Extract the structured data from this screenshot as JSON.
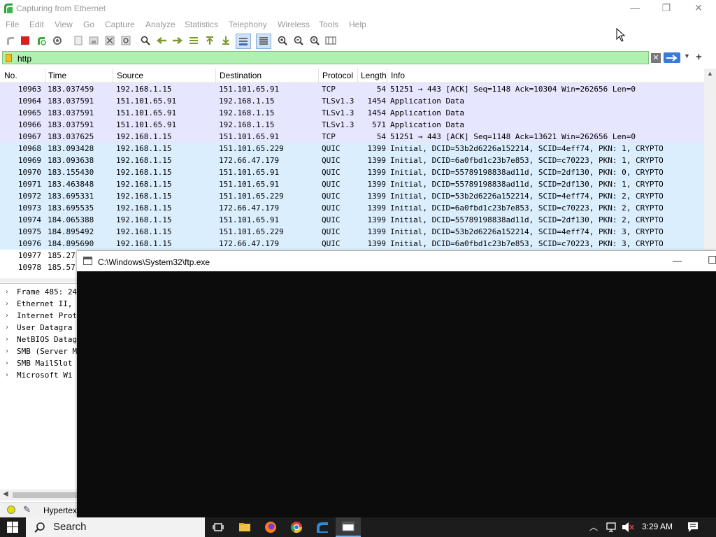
{
  "window": {
    "title": "Capturing from Ethernet",
    "min": "—",
    "max": "❐",
    "close": "✕"
  },
  "menu": [
    "File",
    "Edit",
    "View",
    "Go",
    "Capture",
    "Analyze",
    "Statistics",
    "Telephony",
    "Wireless",
    "Tools",
    "Help"
  ],
  "filter": {
    "value": "http",
    "add_label": "+"
  },
  "columns": {
    "no": "No.",
    "time": "Time",
    "source": "Source",
    "destination": "Destination",
    "protocol": "Protocol",
    "length": "Length",
    "info": "Info"
  },
  "packets": [
    {
      "no": "10963",
      "time": "183.037459",
      "src": "192.168.1.15",
      "dst": "151.101.65.91",
      "proto": "TCP",
      "len": "54",
      "info": "51251 → 443 [ACK] Seq=1148 Ack=10304 Win=262656 Len=0"
    },
    {
      "no": "10964",
      "time": "183.037591",
      "src": "151.101.65.91",
      "dst": "192.168.1.15",
      "proto": "TLSv1.3",
      "len": "1454",
      "info": "Application Data"
    },
    {
      "no": "10965",
      "time": "183.037591",
      "src": "151.101.65.91",
      "dst": "192.168.1.15",
      "proto": "TLSv1.3",
      "len": "1454",
      "info": "Application Data"
    },
    {
      "no": "10966",
      "time": "183.037591",
      "src": "151.101.65.91",
      "dst": "192.168.1.15",
      "proto": "TLSv1.3",
      "len": "571",
      "info": "Application Data"
    },
    {
      "no": "10967",
      "time": "183.037625",
      "src": "192.168.1.15",
      "dst": "151.101.65.91",
      "proto": "TCP",
      "len": "54",
      "info": "51251 → 443 [ACK] Seq=1148 Ack=13621 Win=262656 Len=0"
    },
    {
      "no": "10968",
      "time": "183.093428",
      "src": "192.168.1.15",
      "dst": "151.101.65.229",
      "proto": "QUIC",
      "len": "1399",
      "info": "Initial, DCID=53b2d6226a152214, SCID=4eff74, PKN: 1, CRYPTO"
    },
    {
      "no": "10969",
      "time": "183.093638",
      "src": "192.168.1.15",
      "dst": "172.66.47.179",
      "proto": "QUIC",
      "len": "1399",
      "info": "Initial, DCID=6a0fbd1c23b7e853, SCID=c70223, PKN: 1, CRYPTO"
    },
    {
      "no": "10970",
      "time": "183.155430",
      "src": "192.168.1.15",
      "dst": "151.101.65.91",
      "proto": "QUIC",
      "len": "1399",
      "info": "Initial, DCID=55789198838ad11d, SCID=2df130, PKN: 0, CRYPTO"
    },
    {
      "no": "10971",
      "time": "183.463848",
      "src": "192.168.1.15",
      "dst": "151.101.65.91",
      "proto": "QUIC",
      "len": "1399",
      "info": "Initial, DCID=55789198838ad11d, SCID=2df130, PKN: 1, CRYPTO"
    },
    {
      "no": "10972",
      "time": "183.695331",
      "src": "192.168.1.15",
      "dst": "151.101.65.229",
      "proto": "QUIC",
      "len": "1399",
      "info": "Initial, DCID=53b2d6226a152214, SCID=4eff74, PKN: 2, CRYPTO"
    },
    {
      "no": "10973",
      "time": "183.695535",
      "src": "192.168.1.15",
      "dst": "172.66.47.179",
      "proto": "QUIC",
      "len": "1399",
      "info": "Initial, DCID=6a0fbd1c23b7e853, SCID=c70223, PKN: 2, CRYPTO"
    },
    {
      "no": "10974",
      "time": "184.065388",
      "src": "192.168.1.15",
      "dst": "151.101.65.91",
      "proto": "QUIC",
      "len": "1399",
      "info": "Initial, DCID=55789198838ad11d, SCID=2df130, PKN: 2, CRYPTO"
    },
    {
      "no": "10975",
      "time": "184.895492",
      "src": "192.168.1.15",
      "dst": "151.101.65.229",
      "proto": "QUIC",
      "len": "1399",
      "info": "Initial, DCID=53b2d6226a152214, SCID=4eff74, PKN: 3, CRYPTO"
    },
    {
      "no": "10976",
      "time": "184.895690",
      "src": "192.168.1.15",
      "dst": "172.66.47.179",
      "proto": "QUIC",
      "len": "1399",
      "info": "Initial, DCID=6a0fbd1c23b7e853, SCID=c70223, PKN: 3, CRYPTO"
    },
    {
      "no": "10977",
      "time": "185.27",
      "src": "",
      "dst": "",
      "proto": "",
      "len": "",
      "info": ""
    },
    {
      "no": "10978",
      "time": "185.57",
      "src": "",
      "dst": "",
      "proto": "",
      "len": "",
      "info": ""
    }
  ],
  "details": [
    "Frame 485: 24",
    "Ethernet II,",
    "Internet Prot",
    "User Datagra",
    "NetBIOS Datag",
    "SMB (Server M",
    "SMB MailSlot",
    "Microsoft Wi"
  ],
  "status": {
    "text": "Hypertex"
  },
  "ftp_window": {
    "title": "C:\\Windows\\System32\\ftp.exe",
    "min": "—",
    "max": "☐"
  },
  "taskbar": {
    "search": "Search",
    "clock": "3:29 AM"
  },
  "colors": {
    "tcp_row": "#e7e6ff",
    "quic_row": "#daeefe",
    "filter_bg": "#b0f0b0",
    "taskbar": "#1c1c1c"
  }
}
